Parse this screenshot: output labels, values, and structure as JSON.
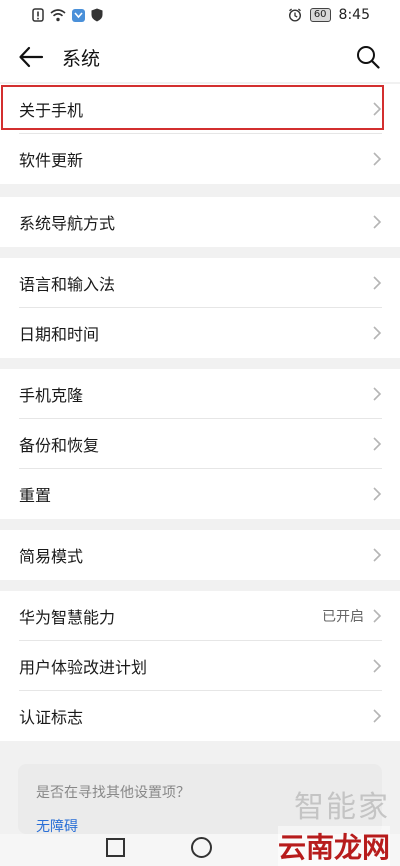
{
  "status_bar": {
    "battery": "60",
    "time": "8:45",
    "icons": [
      "alert-icon",
      "wifi-icon",
      "app-icon",
      "shield-icon",
      "alarm-icon"
    ]
  },
  "header": {
    "title": "系统",
    "back_icon": "back-arrow-icon",
    "search_icon": "search-icon"
  },
  "groups": [
    {
      "items": [
        {
          "label": "关于手机"
        },
        {
          "label": "软件更新"
        }
      ]
    },
    {
      "items": [
        {
          "label": "系统导航方式"
        }
      ]
    },
    {
      "items": [
        {
          "label": "语言和输入法"
        },
        {
          "label": "日期和时间"
        }
      ]
    },
    {
      "items": [
        {
          "label": "手机克隆"
        },
        {
          "label": "备份和恢复"
        },
        {
          "label": "重置"
        }
      ]
    },
    {
      "items": [
        {
          "label": "简易模式"
        }
      ]
    },
    {
      "items": [
        {
          "label": "华为智慧能力",
          "value": "已开启"
        },
        {
          "label": "用户体验改进计划"
        },
        {
          "label": "认证标志"
        }
      ]
    }
  ],
  "suggestion": {
    "question": "是否在寻找其他设置项？",
    "link": "无障碍"
  },
  "watermark": {
    "top": "智能家",
    "bottom": "云南龙网"
  },
  "colors": {
    "highlight": "#d32f2f",
    "link": "#2a6fd6"
  }
}
